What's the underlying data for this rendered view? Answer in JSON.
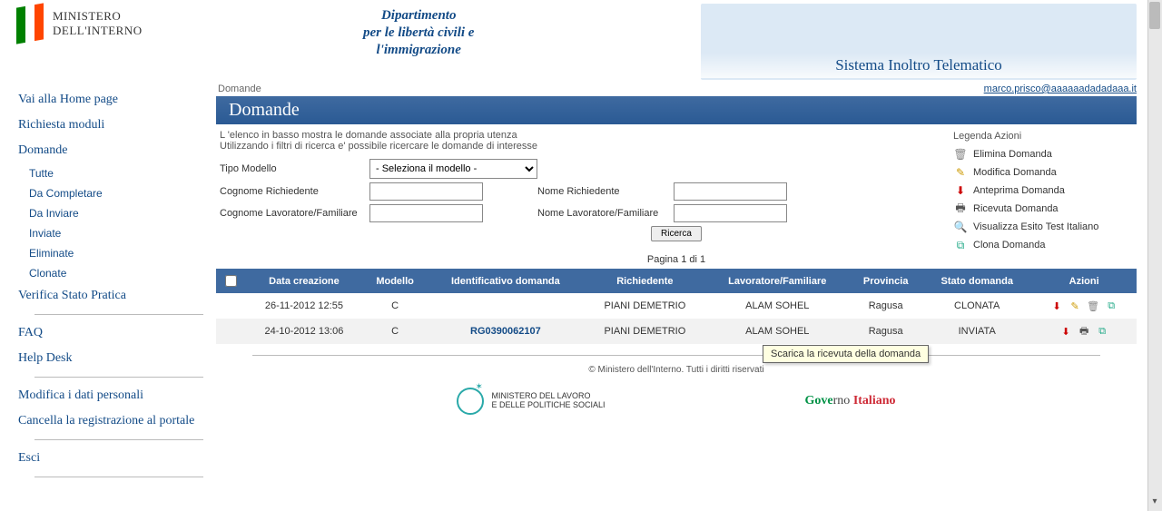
{
  "header": {
    "ministero_line1": "MINISTERO",
    "ministero_line2": "DELL'INTERNO",
    "dept_line1": "Dipartimento",
    "dept_line2": "per le libertà civili e",
    "dept_line3": "l'immigrazione",
    "system_title": "Sistema Inoltro Telematico"
  },
  "sidebar": {
    "home": "Vai alla Home page",
    "richiesta": "Richiesta moduli",
    "domande": "Domande",
    "sub": {
      "tutte": "Tutte",
      "da_completare": "Da Completare",
      "da_inviare": "Da Inviare",
      "inviate": "Inviate",
      "eliminate": "Eliminate",
      "clonate": "Clonate"
    },
    "verifica": "Verifica Stato Pratica",
    "faq": "FAQ",
    "helpdesk": "Help Desk",
    "modifica": "Modifica i dati personali",
    "cancella": "Cancella la registrazione al portale",
    "esci": "Esci"
  },
  "breadcrumb": "Domande",
  "user_email": "marco.prisco@aaaaaadadadaaa.it",
  "page_title": "Domande",
  "intro_line1": "L 'elenco in basso mostra le domande associate alla propria utenza",
  "intro_line2": "Utilizzando i filtri di ricerca e' possibile ricercare le domande di interesse",
  "filters": {
    "tipo_modello": "Tipo Modello",
    "select_placeholder": "- Seleziona il modello -",
    "cognome_rich": "Cognome Richiedente",
    "nome_rich": "Nome Richiedente",
    "cognome_lav": "Cognome Lavoratore/Familiare",
    "nome_lav": "Nome Lavoratore/Familiare",
    "ricerca": "Ricerca"
  },
  "legend": {
    "title": "Legenda Azioni",
    "elimina": "Elimina Domanda",
    "modifica": "Modifica Domanda",
    "anteprima": "Anteprima Domanda",
    "ricevuta": "Ricevuta Domanda",
    "esito": "Visualizza Esito Test Italiano",
    "clona": "Clona Domanda"
  },
  "pager": "Pagina 1 di 1",
  "table": {
    "headers": {
      "data": "Data creazione",
      "modello": "Modello",
      "ident": "Identificativo domanda",
      "richiedente": "Richiedente",
      "lavoratore": "Lavoratore/Familiare",
      "provincia": "Provincia",
      "stato": "Stato domanda",
      "azioni": "Azioni"
    },
    "rows": [
      {
        "data": "26-11-2012 12:55",
        "modello": "C",
        "ident": "",
        "richiedente": "PIANI DEMETRIO",
        "lavoratore": "ALAM SOHEL",
        "provincia": "Ragusa",
        "stato": "CLONATA"
      },
      {
        "data": "24-10-2012 13:06",
        "modello": "C",
        "ident": "RG0390062107",
        "richiedente": "PIANI DEMETRIO",
        "lavoratore": "ALAM SOHEL",
        "provincia": "Ragusa",
        "stato": "INVIATA"
      }
    ]
  },
  "tooltip": "Scarica la ricevuta della domanda",
  "footer": {
    "copyright": "© Ministero dell'Interno. Tutti i diritti riservati",
    "lavoro_line1": "MINISTERO DEL LAVORO",
    "lavoro_line2": "E DELLE POLITICHE SOCIALI",
    "gov_p1": "Gove",
    "gov_p2": "rno ",
    "gov_p3": "Italiano"
  }
}
